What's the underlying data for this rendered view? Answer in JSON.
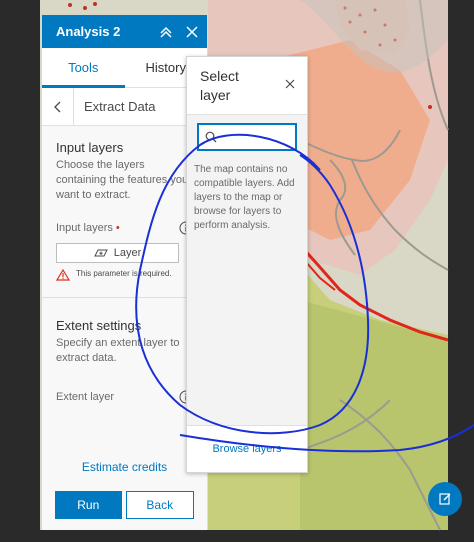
{
  "panel": {
    "title": "Analysis 2",
    "tabs": [
      {
        "label": "Tools",
        "active": true
      },
      {
        "label": "History",
        "active": false
      }
    ],
    "tool_name": "Extract Data",
    "input_layers": {
      "title": "Input layers",
      "description": "Choose the layers containing the features you want to extract.",
      "field_label": "Input layers",
      "required_mark": "•",
      "layer_button_label": "Layer",
      "error_text": "This parameter is required."
    },
    "extent_settings": {
      "title": "Extent settings",
      "description": "Specify an extent layer to extract data.",
      "field_label": "Extent layer"
    },
    "estimate_credits_label": "Estimate credits",
    "run_label": "Run",
    "back_label": "Back"
  },
  "popover": {
    "title": "Select layer",
    "search_value": "",
    "message": "The map contains no compatible layers. Add layers to the map or browse for layers to perform analysis.",
    "browse_label": "Browse layers"
  },
  "icons": {
    "header_collapse": "chevrons-up-icon",
    "header_close": "close-icon",
    "tool_back": "chevron-left-icon",
    "info": "info-icon",
    "layer": "layer-add-icon",
    "warning": "warning-icon",
    "search": "search-icon",
    "popover_close": "close-icon",
    "floating": "edit-icon"
  },
  "colors": {
    "accent": "#0079c1",
    "error": "#d83020",
    "annotation": "#1a2fd6"
  }
}
